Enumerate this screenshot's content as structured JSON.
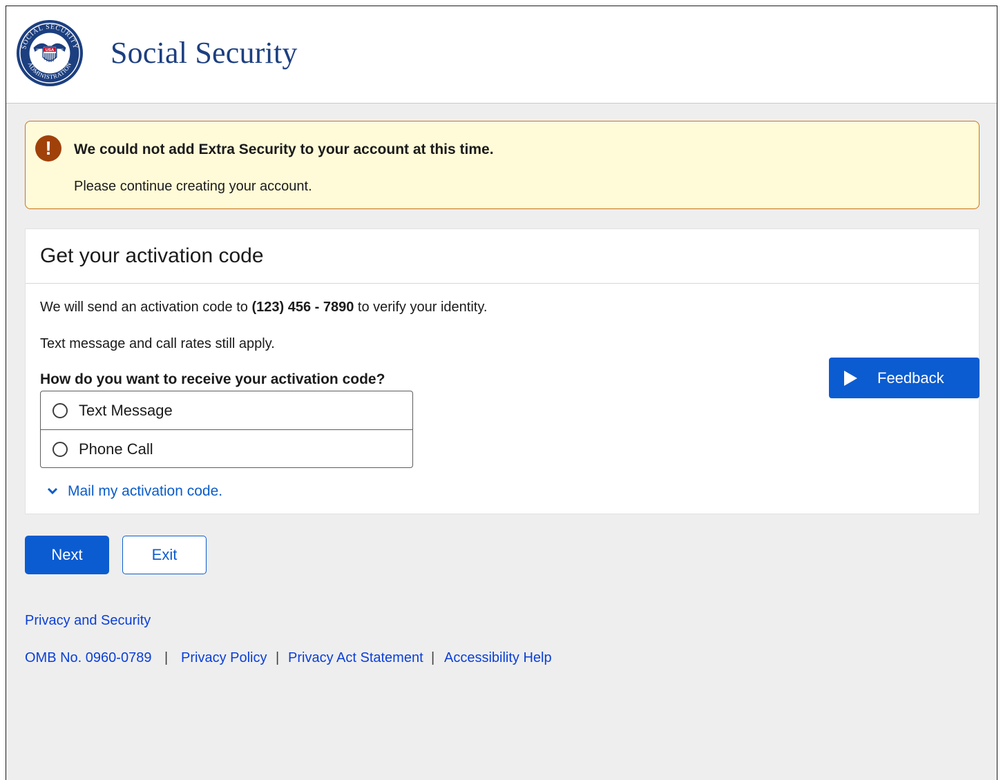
{
  "header": {
    "title": "Social Security",
    "logo_text_top": "SOCIAL SECURITY",
    "logo_text_bottom": "ADMINISTRATION",
    "logo_badge": "USA"
  },
  "alert": {
    "icon": "exclamation-icon",
    "title": "We could not add Extra Security to your account at this time.",
    "body": "Please continue creating your account."
  },
  "card": {
    "title": "Get your activation code",
    "send_prefix": "We will send an activation code to ",
    "phone": "(123) 456 - 7890",
    "send_suffix": " to verify your identity.",
    "rates_note": "Text message and call rates still apply.",
    "question": "How do you want to receive your activation code?",
    "options": [
      {
        "label": "Text Message",
        "selected": false
      },
      {
        "label": "Phone Call",
        "selected": false
      }
    ],
    "mail_link": "Mail my activation code."
  },
  "feedback": {
    "label": "Feedback"
  },
  "actions": {
    "next_label": "Next",
    "exit_label": "Exit"
  },
  "footer": {
    "privacy_security": "Privacy and Security",
    "omb": "OMB No. 0960-0789",
    "privacy_policy": "Privacy Policy",
    "privacy_act": "Privacy Act Statement",
    "accessibility": "Accessibility Help",
    "separator": "|"
  },
  "colors": {
    "brand_navy": "#1c3f80",
    "primary_blue": "#0b5cd0",
    "link_blue": "#0b3fd6",
    "alert_bg": "#fffbd8",
    "alert_border": "#c9741a",
    "alert_icon": "#a0410a"
  }
}
